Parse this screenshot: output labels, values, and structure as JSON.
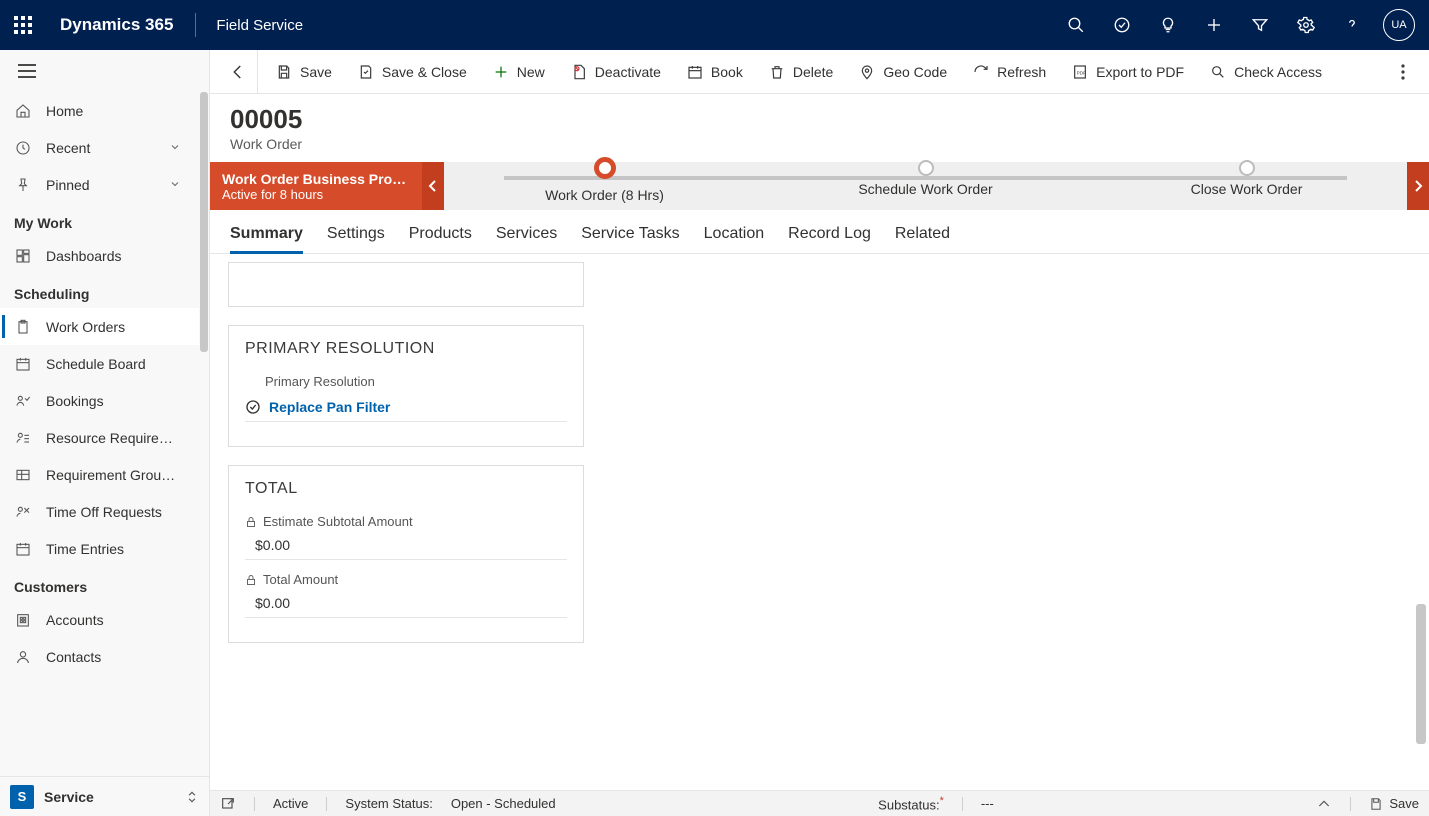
{
  "top": {
    "brand": "Dynamics 365",
    "area": "Field Service",
    "avatar": "UA"
  },
  "sidebar": {
    "top": [
      {
        "icon": "home",
        "label": "Home"
      },
      {
        "icon": "clock",
        "label": "Recent",
        "chev": true
      },
      {
        "icon": "pin",
        "label": "Pinned",
        "chev": true
      }
    ],
    "groups": [
      {
        "title": "My Work",
        "items": [
          {
            "icon": "dash",
            "label": "Dashboards"
          }
        ]
      },
      {
        "title": "Scheduling",
        "items": [
          {
            "icon": "clip",
            "label": "Work Orders",
            "selected": true
          },
          {
            "icon": "cal",
            "label": "Schedule Board"
          },
          {
            "icon": "book",
            "label": "Bookings"
          },
          {
            "icon": "req",
            "label": "Resource Require…"
          },
          {
            "icon": "grp",
            "label": "Requirement Grou…"
          },
          {
            "icon": "off",
            "label": "Time Off Requests"
          },
          {
            "icon": "cal",
            "label": "Time Entries"
          }
        ]
      },
      {
        "title": "Customers",
        "items": [
          {
            "icon": "acct",
            "label": "Accounts"
          },
          {
            "icon": "contact",
            "label": "Contacts"
          }
        ]
      }
    ],
    "area": {
      "tile": "S",
      "label": "Service"
    }
  },
  "commands": {
    "save": "Save",
    "saveclose": "Save & Close",
    "new": "New",
    "deactivate": "Deactivate",
    "book": "Book",
    "delete": "Delete",
    "geo": "Geo Code",
    "refresh": "Refresh",
    "pdf": "Export to PDF",
    "check": "Check Access"
  },
  "header": {
    "title": "00005",
    "subtitle": "Work Order"
  },
  "bpf": {
    "name": "Work Order Business Pro…",
    "duration": "Active for 8 hours",
    "stages": [
      {
        "label": "Work Order  (8 Hrs)",
        "active": true
      },
      {
        "label": "Schedule Work Order"
      },
      {
        "label": "Close Work Order"
      }
    ]
  },
  "tabs": [
    "Summary",
    "Settings",
    "Products",
    "Services",
    "Service Tasks",
    "Location",
    "Record Log",
    "Related"
  ],
  "activeTab": "Summary",
  "cards": {
    "primary": {
      "title": "PRIMARY RESOLUTION",
      "label": "Primary Resolution",
      "value": "Replace Pan Filter"
    },
    "total": {
      "title": "TOTAL",
      "est_label": "Estimate Subtotal Amount",
      "est_value": "$0.00",
      "tot_label": "Total Amount",
      "tot_value": "$0.00"
    }
  },
  "status": {
    "state": "Active",
    "sys_label": "System Status:",
    "sys_value": "Open - Scheduled",
    "sub_label": "Substatus:",
    "sub_mark": "*",
    "sub_value": "---",
    "save": "Save"
  }
}
